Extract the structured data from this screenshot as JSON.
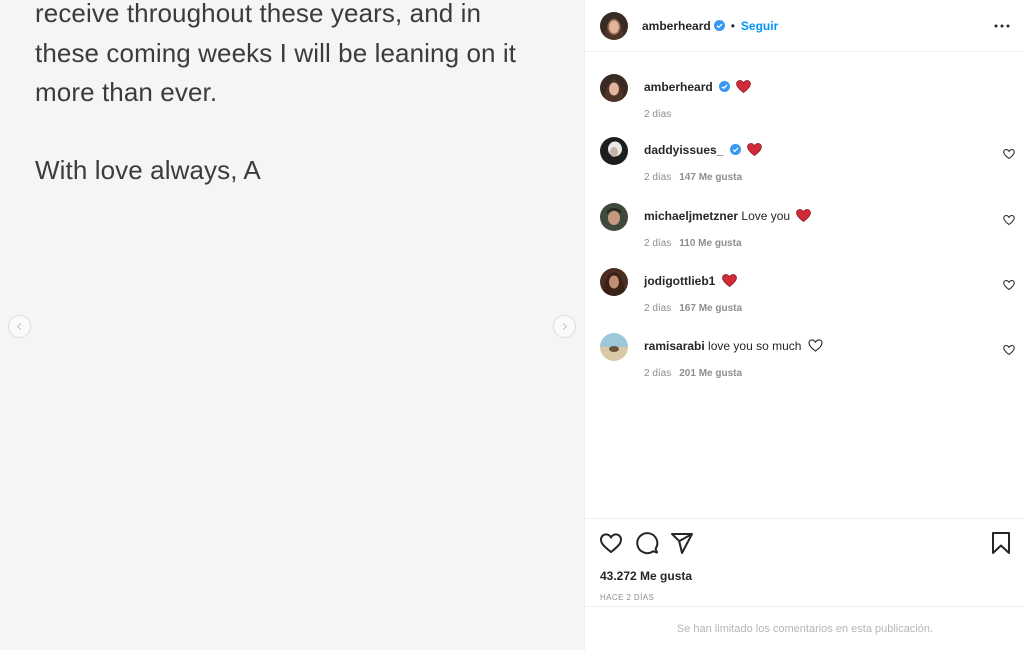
{
  "post_text": {
    "lines": [
      "receive throughout these years, and in",
      "these coming weeks I will be leaning on it",
      "more than ever.",
      "With love always, A"
    ]
  },
  "header": {
    "username": "amberheard",
    "separator": "•",
    "follow_label": "Seguir"
  },
  "caption": {
    "username": "amberheard",
    "time": "2 días"
  },
  "comments": [
    {
      "username": "daddyissues_",
      "verified": true,
      "text": "",
      "time": "2 días",
      "likes": "147 Me gusta"
    },
    {
      "username": "michaeljmetzner",
      "verified": false,
      "text": "Love you",
      "time": "2 días",
      "likes": "110 Me gusta"
    },
    {
      "username": "jodigottlieb1",
      "verified": false,
      "text": "",
      "time": "2 días",
      "likes": "167 Me gusta"
    },
    {
      "username": "ramisarabi",
      "verified": false,
      "text": "love you so much",
      "time": "2 días",
      "likes": "201 Me gusta"
    }
  ],
  "footer": {
    "likes": "43.272 Me gusta",
    "time_ago": "HACE 2 DÍAS",
    "comments_limited": "Se han limitado los comentarios en esta publicación."
  },
  "colors": {
    "accent": "#0095f6",
    "heart": "#d12b3a",
    "muted": "#8e8e8e"
  }
}
